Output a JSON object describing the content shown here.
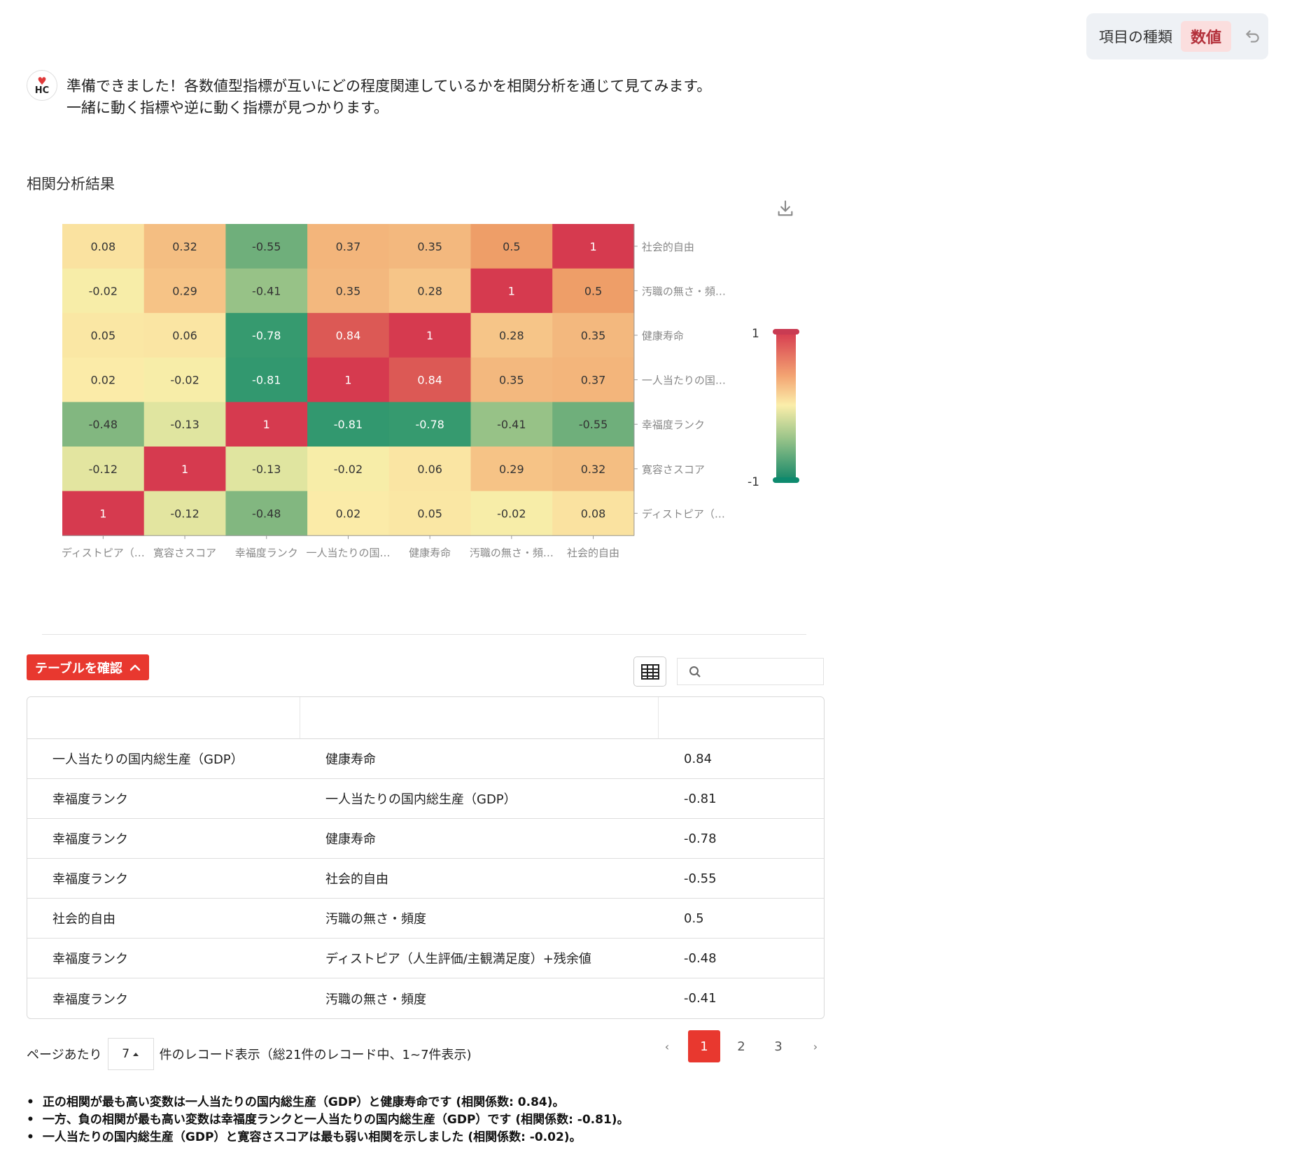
{
  "header": {
    "type_label": "項目の種類",
    "type_value": "数値"
  },
  "message": {
    "line1": "準備できました！各数値型指標が互いにどの程度関連しているかを相関分析を通じて見てみます。",
    "line2": "一緒に動く指標や逆に動く指標が見つかります。"
  },
  "section_title": "相関分析結果",
  "chart_data": {
    "type": "heatmap",
    "x_labels": [
      "ディストピア（…",
      "寛容さスコア",
      "幸福度ランク",
      "一人当たりの国…",
      "健康寿命",
      "汚職の無さ・頻…",
      "社会的自由"
    ],
    "y_labels": [
      "社会的自由",
      "汚職の無さ・頻…",
      "健康寿命",
      "一人当たりの国…",
      "幸福度ランク",
      "寛容さスコア",
      "ディストピア（…"
    ],
    "values": [
      [
        0.08,
        0.32,
        -0.55,
        0.37,
        0.35,
        0.5,
        1
      ],
      [
        -0.02,
        0.29,
        -0.41,
        0.35,
        0.28,
        1,
        0.5
      ],
      [
        0.05,
        0.06,
        -0.78,
        0.84,
        1,
        0.28,
        0.35
      ],
      [
        0.02,
        -0.02,
        -0.81,
        1,
        0.84,
        0.35,
        0.37
      ],
      [
        -0.48,
        -0.13,
        1,
        -0.81,
        -0.78,
        -0.41,
        -0.55
      ],
      [
        -0.12,
        1,
        -0.13,
        -0.02,
        0.06,
        0.29,
        0.32
      ],
      [
        1,
        -0.12,
        -0.48,
        0.02,
        0.05,
        -0.02,
        0.08
      ]
    ],
    "color_range": [
      -1,
      1
    ],
    "legend_labels": {
      "max": "1",
      "min": "-1"
    },
    "colors": {
      "high": "#d63a4f",
      "mid": "#fbeeaa",
      "low": "#1a8a6a"
    }
  },
  "table_toggle_label": "テーブルを確認",
  "search": {
    "placeholder": ""
  },
  "table": {
    "rows": [
      [
        "一人当たりの国内総生産（GDP）",
        "健康寿命",
        "0.84"
      ],
      [
        "幸福度ランク",
        "一人当たりの国内総生産（GDP）",
        "-0.81"
      ],
      [
        "幸福度ランク",
        "健康寿命",
        "-0.78"
      ],
      [
        "幸福度ランク",
        "社会的自由",
        "-0.55"
      ],
      [
        "社会的自由",
        "汚職の無さ・頻度",
        "0.5"
      ],
      [
        "幸福度ランク",
        "ディストピア（人生評価/主観満足度）+残余値",
        "-0.48"
      ],
      [
        "幸福度ランク",
        "汚職の無さ・頻度",
        "-0.41"
      ]
    ]
  },
  "pagination": {
    "prefix": "ページあたり",
    "per_page": "7",
    "suffix": "件のレコード表示（総21件のレコード中、1~7件表示)",
    "pages": [
      "1",
      "2",
      "3"
    ],
    "prev": "‹",
    "next": "›"
  },
  "insights": [
    "正の相関が最も高い変数は一人当たりの国内総生産（GDP）と健康寿命です (相関係数: 0.84)。",
    "一方、負の相関が最も高い変数は幸福度ランクと一人当たりの国内総生産（GDP）です (相関係数: -0.81)。",
    "一人当たりの国内総生産（GDP）と寛容さスコアは最も弱い相関を示しました (相関係数: -0.02)。"
  ],
  "accent_color": "#e8382f"
}
